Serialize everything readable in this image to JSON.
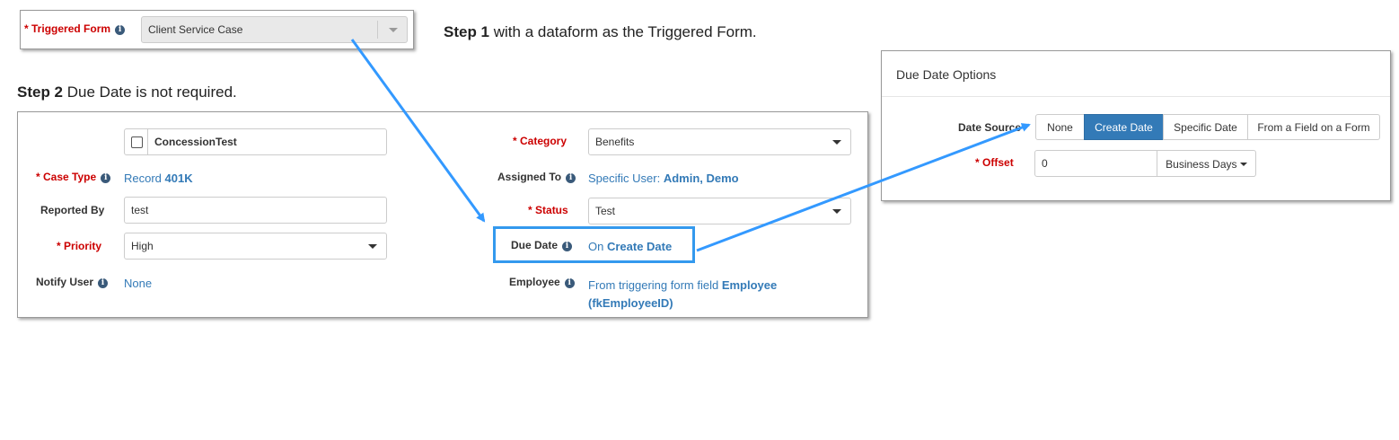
{
  "trigger": {
    "label_prefix": "* ",
    "label": "Triggered Form",
    "value": "Client Service Case"
  },
  "step1": {
    "bold": "Step 1",
    "text": " with a dataform as the Triggered Form."
  },
  "step2": {
    "bold": "Step 2",
    "text": " Due Date is not required."
  },
  "case": {
    "concession_name": "ConcessionTest",
    "case_type": {
      "prefix": "* ",
      "label": "Case Type",
      "value_pre": "Record ",
      "value_bold": "401K"
    },
    "reported_by": {
      "label": "Reported By",
      "value": "test"
    },
    "priority": {
      "prefix": "* ",
      "label": "Priority",
      "value": "High"
    },
    "notify_user": {
      "label": "Notify User",
      "value": "None"
    },
    "category": {
      "prefix": "* ",
      "label": "Category",
      "value": "Benefits"
    },
    "assigned_to": {
      "label": "Assigned To",
      "value_pre": "Specific User: ",
      "value_bold": "Admin, Demo"
    },
    "status": {
      "prefix": "* ",
      "label": "Status",
      "value": "Test"
    },
    "due_date": {
      "label": "Due Date",
      "value_pre": "On ",
      "value_bold": "Create Date"
    },
    "employee": {
      "label": "Employee",
      "value_pre": "From triggering form field ",
      "value_bold": "Employee",
      "value_bold2": "(fkEmployeeID)"
    }
  },
  "due_options": {
    "title": "Due Date Options",
    "date_source_label": "Date Source",
    "buttons": [
      "None",
      "Create Date",
      "Specific Date",
      "From a Field on a Form"
    ],
    "active_index": 1,
    "offset": {
      "prefix": "* ",
      "label": "Offset",
      "value": "0",
      "unit": "Business Days"
    }
  },
  "colors": {
    "link": "#337ab7",
    "required": "#cc0000",
    "active_button": "#337ab7",
    "arrow": "#3399ff"
  },
  "icons": [
    "info-icon",
    "caret-down-icon",
    "checkbox-icon",
    "arrow-annotation"
  ]
}
